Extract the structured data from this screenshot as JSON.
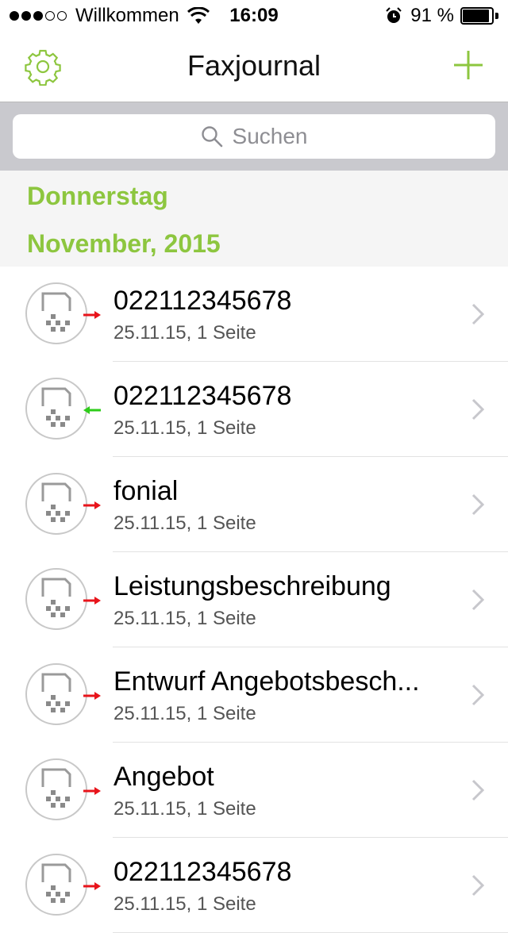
{
  "status_bar": {
    "carrier": "Willkommen",
    "time": "16:09",
    "battery_percent": "91 %",
    "battery_level": 0.91
  },
  "nav": {
    "title": "Faxjournal"
  },
  "search": {
    "placeholder": "Suchen"
  },
  "section": {
    "day": "Donnerstag",
    "month": "November, 2015"
  },
  "colors": {
    "accent": "#8dc63f",
    "outgoing": "#e8141b",
    "incoming": "#2ecc1a"
  },
  "faxes": [
    {
      "title": "022112345678",
      "subtitle": "25.11.15, 1 Seite",
      "direction": "outgoing"
    },
    {
      "title": "022112345678",
      "subtitle": "25.11.15, 1 Seite",
      "direction": "incoming"
    },
    {
      "title": "fonial",
      "subtitle": "25.11.15, 1 Seite",
      "direction": "outgoing"
    },
    {
      "title": "Leistungsbeschreibung",
      "subtitle": "25.11.15, 1 Seite",
      "direction": "outgoing"
    },
    {
      "title": "Entwurf Angebotsbesch...",
      "subtitle": "25.11.15, 1 Seite",
      "direction": "outgoing"
    },
    {
      "title": "Angebot",
      "subtitle": "25.11.15, 1 Seite",
      "direction": "outgoing"
    },
    {
      "title": "022112345678",
      "subtitle": "25.11.15, 1 Seite",
      "direction": "outgoing"
    }
  ]
}
